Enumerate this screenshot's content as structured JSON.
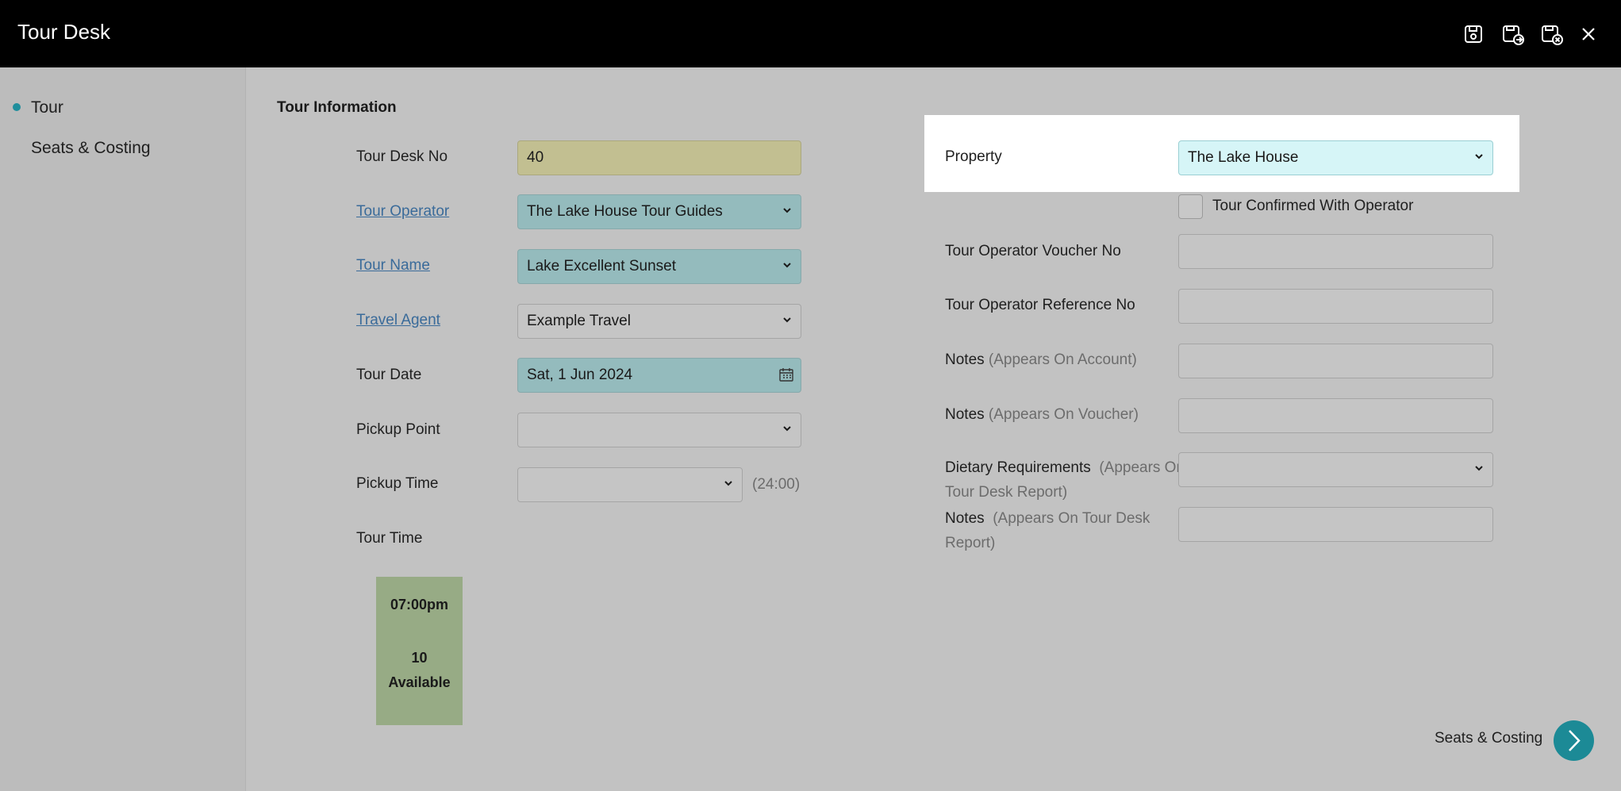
{
  "window": {
    "title": "Tour Desk",
    "icons": [
      "save-icon",
      "save-and-new-icon",
      "save-and-close-icon",
      "close-icon"
    ]
  },
  "sidebar": {
    "items": [
      {
        "label": "Tour",
        "active": true
      },
      {
        "label": "Seats & Costing",
        "active": false
      }
    ]
  },
  "section": {
    "title": "Tour Information"
  },
  "left_form": {
    "tour_desk_no": {
      "label": "Tour Desk No",
      "value": "40"
    },
    "tour_operator": {
      "label": "Tour Operator",
      "value": "The Lake House Tour Guides"
    },
    "tour_name": {
      "label": "Tour Name",
      "value": "Lake Excellent Sunset"
    },
    "travel_agent": {
      "label": "Travel Agent",
      "value": "Example Travel"
    },
    "tour_date": {
      "label": "Tour Date",
      "value": "Sat, 1 Jun 2024"
    },
    "pickup_point": {
      "label": "Pickup Point",
      "value": ""
    },
    "pickup_time": {
      "label": "Pickup Time",
      "value": "",
      "hint": "(24:00)"
    },
    "tour_time": {
      "label": "Tour Time",
      "slot": {
        "time": "07:00pm",
        "count": "10",
        "status": "Available"
      }
    }
  },
  "right_form": {
    "property": {
      "label": "Property",
      "value": "The Lake House"
    },
    "confirmed": {
      "label": "Tour Confirmed With Operator",
      "checked": false
    },
    "voucher_no": {
      "label": "Tour Operator Voucher No",
      "value": ""
    },
    "reference_no": {
      "label": "Tour Operator Reference No",
      "value": ""
    },
    "notes_account": {
      "label": "Notes",
      "sub": "(Appears On Account)",
      "value": ""
    },
    "notes_voucher": {
      "label": "Notes",
      "sub": "(Appears On Voucher)",
      "value": ""
    },
    "dietary": {
      "label": "Dietary Requirements",
      "sub_line1": "(Appears On",
      "sub_line2": "Tour Desk Report)",
      "value": ""
    },
    "notes_report": {
      "label": "Notes",
      "sub_line1": "(Appears On Tour Desk",
      "sub_line2": "Report)",
      "value": ""
    }
  },
  "footer": {
    "next_label": "Seats & Costing"
  },
  "colors": {
    "accent": "#1c8a96",
    "yellow_field": "#c2bf91",
    "teal_field": "#94bbbd",
    "cyan_field": "#d6f5f7",
    "slot_green": "#97ab85",
    "link": "#3a6b9a"
  }
}
